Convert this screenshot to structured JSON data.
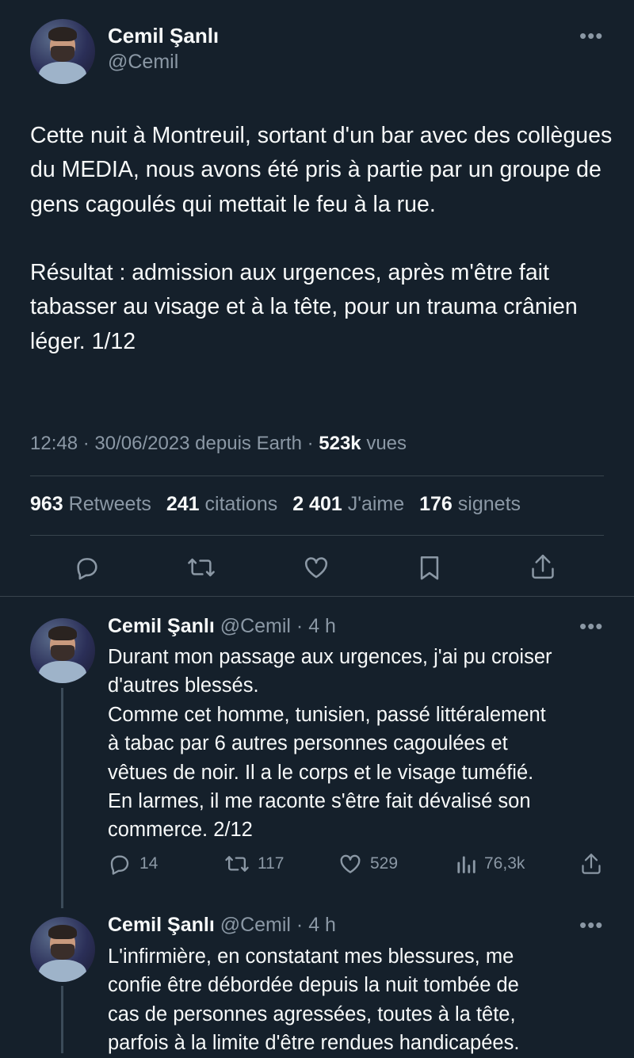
{
  "main_tweet": {
    "author_name": "Cemil Şanlı",
    "author_handle": "@Cemil",
    "text_p1": "Cette nuit à Montreuil, sortant d'un bar avec des collègues du MEDIA, nous avons été pris à partie par un groupe de gens cagoulés qui mettait le feu à la rue.",
    "text_p2": "Résultat : admission aux urgences, après m'être fait tabasser au visage et à la tête, pour un trauma crânien léger. 1/12",
    "meta_prefix": "12:48 · 30/06/2023 depuis Earth · ",
    "views_count": "523k",
    "views_label": " vues",
    "stats": {
      "retweets_count": "963",
      "retweets_label": "Retweets",
      "quotes_count": "241",
      "quotes_label": "citations",
      "likes_count": "2 401",
      "likes_label": "J'aime",
      "bookmarks_count": "176",
      "bookmarks_label": "signets"
    }
  },
  "replies": [
    {
      "author_name": "Cemil Şanlı",
      "meta": "@Cemil · 4 h",
      "text_lines": [
        "Durant mon passage aux urgences, j'ai pu croiser",
        "d'autres blessés.",
        "Comme cet homme, tunisien, passé littéralement",
        "à tabac par 6 autres personnes cagoulées et",
        "vêtues de noir. Il a le corps et le visage tuméfié.",
        "En larmes, il me raconte s'être fait dévalisé son",
        "commerce. 2/12"
      ],
      "replies_count": "14",
      "retweets_count": "117",
      "likes_count": "529",
      "views_count": "76,3k"
    },
    {
      "author_name": "Cemil Şanlı",
      "meta": "@Cemil · 4 h",
      "text_lines": [
        "L'infirmière, en constatant mes blessures, me",
        "confie être débordée depuis la nuit tombée de",
        "cas de personnes agressées, toutes à la tête,",
        "parfois à la limite d'être rendues handicapées."
      ]
    }
  ],
  "icons": {
    "more": "more-horizontal-icon",
    "reply": "reply-icon",
    "retweet": "retweet-icon",
    "like": "heart-icon",
    "bookmark": "bookmark-icon",
    "share": "share-icon",
    "views": "views-icon"
  },
  "colors": {
    "background": "#15202b",
    "text": "#f7f9f9",
    "muted": "#8b98a5",
    "divider": "#38444d"
  }
}
